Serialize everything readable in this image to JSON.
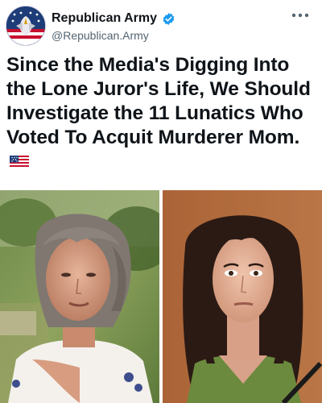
{
  "account": {
    "display_name": "Republican Army",
    "handle": "@Republican.Army",
    "verified": true,
    "avatar_icon": "eagle-flag-avatar"
  },
  "post": {
    "text": "Since the Media's Digging Into the Lone Juror's Life, We Should Investigate the 11 Lunatics Who Voted To Acquit Murderer Mom.",
    "emoji": "us-flag-icon"
  },
  "media": {
    "left_image": "older-woman-outdoors-photo",
    "right_image": "young-woman-courtroom-photo"
  },
  "colors": {
    "verified_blue": "#1d9bf0",
    "text": "#0f1419",
    "muted": "#536471"
  }
}
